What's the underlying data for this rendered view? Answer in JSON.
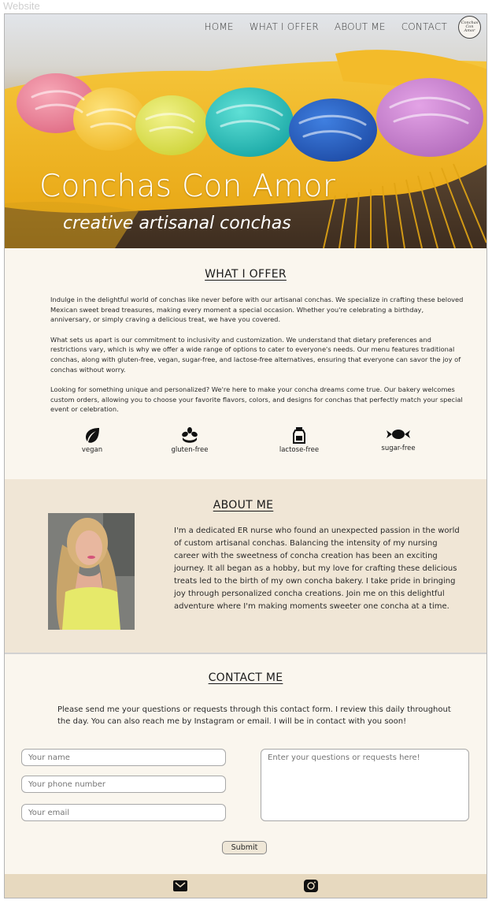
{
  "window": {
    "title": "Website"
  },
  "nav": {
    "items": [
      "HOME",
      "WHAT I OFFER",
      "ABOUT ME",
      "CONTACT"
    ],
    "logo_text": "Conchas Con Amor"
  },
  "hero": {
    "title": "Conchas Con Amor",
    "subtitle": "creative artisanal conchas"
  },
  "offer": {
    "title": "WHAT I OFFER",
    "paragraphs": [
      "Indulge in the delightful world of conchas like never before with our artisanal conchas. We specialize in crafting these beloved Mexican sweet bread treasures, making every moment a special occasion. Whether you're celebrating a birthday, anniversary, or simply craving a delicious treat, we have you covered.",
      "What sets us apart is our commitment to inclusivity and customization. We understand that dietary preferences and restrictions vary, which is why we offer a wide range of options to cater to everyone's needs. Our menu features traditional conchas, along with gluten-free, vegan, sugar-free, and lactose-free alternatives, ensuring that everyone can savor the joy of conchas without worry.",
      "Looking for something unique and personalized? We're here to make your concha dreams come true. Our bakery welcomes custom orders, allowing you to choose your favorite flavors, colors, and designs for conchas that perfectly match your special event or celebration."
    ],
    "diets": [
      {
        "icon": "leaf-icon",
        "label": "vegan"
      },
      {
        "icon": "wheat-icon",
        "label": "gluten-free"
      },
      {
        "icon": "milk-bottle-icon",
        "label": "lactose-free"
      },
      {
        "icon": "candy-icon",
        "label": "sugar-free"
      }
    ]
  },
  "about": {
    "title": "ABOUT ME",
    "text": "I'm a dedicated ER nurse who found an unexpected passion in the world of custom artisanal conchas. Balancing the intensity of my nursing career with the sweetness of concha creation has been an exciting journey. It all began as a hobby, but my love for crafting these delicious treats led to the birth of my own concha bakery. I take pride in bringing joy through personalized concha creations. Join me on this delightful adventure where I'm making moments sweeter one concha at a time."
  },
  "contact": {
    "title": "CONTACT ME",
    "text": "Please send me your questions or requests through this contact form. I review this daily throughout the day. You can also reach me by Instagram or email.  I will be in contact with you soon!",
    "name_placeholder": "Your name",
    "phone_placeholder": "Your phone number",
    "email_placeholder": "Your email",
    "message_placeholder": "Enter your questions or requests here!",
    "submit_label": "Submit"
  },
  "footer": {
    "icons": [
      "mail-icon",
      "instagram-icon"
    ]
  },
  "colors": {
    "cream": "#faf6ee",
    "about_bg": "#f0e6d6",
    "footer_bg": "#e7d9bf"
  }
}
